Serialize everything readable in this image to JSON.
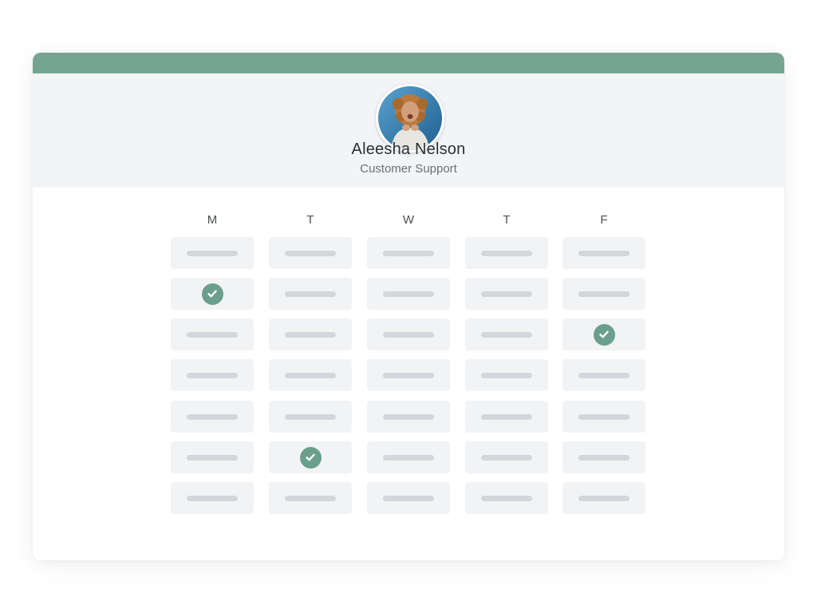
{
  "profile": {
    "name": "Aleesha Nelson",
    "role": "Customer Support",
    "avatar_icon": "person-photo"
  },
  "schedule": {
    "days": [
      "M",
      "T",
      "W",
      "T",
      "F"
    ],
    "slot_rows": 7,
    "checked": [
      [
        1,
        0
      ],
      [
        2,
        4
      ],
      [
        5,
        1
      ]
    ]
  },
  "colors": {
    "accent": "#76a493",
    "header_bg": "#f3f4f6",
    "slot_bg": "#f2f3f5",
    "slot_bar": "#d3d7dc",
    "check_bg": "#6a9f8c"
  }
}
